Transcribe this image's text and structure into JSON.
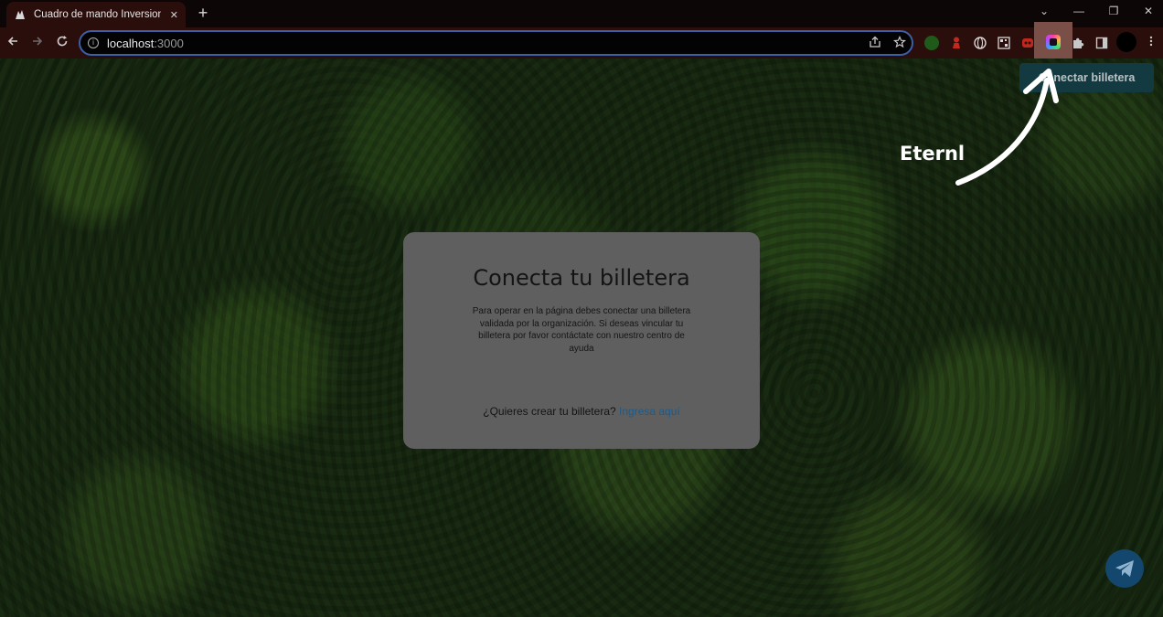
{
  "browser": {
    "tab_title": "Cuadro de mando Inversionista",
    "tab_close": "✕",
    "new_tab": "+",
    "url_host": "localhost",
    "url_port": ":3000",
    "window_controls": {
      "tabs_search": "⌄",
      "minimize": "—",
      "restore": "❐",
      "close": "✕"
    },
    "extensions": [
      "green-extension-icon",
      "red-pawn-extension-icon",
      "globe-extension-icon",
      "qr-extension-icon",
      "red-extension-icon",
      "eternl-extension-icon",
      "puzzle-icon",
      "side-panel-icon"
    ]
  },
  "page": {
    "connect_button": "Conectar billetera",
    "annotation": "Eternl",
    "modal": {
      "title": "Conecta tu billetera",
      "body": "Para operar en la página debes conectar una billetera validada por la organización. Si deseas vincular tu billetera por favor contáctate con nuestro centro de ayuda",
      "footer_text": "¿Quieres crear tu billetera?",
      "footer_link": "Ingresa aquí"
    }
  },
  "colors": {
    "chrome_bg": "#2a0e0c",
    "omnibox_border": "#3d5fa8",
    "modal_bg": "#5f5f5f",
    "link": "#1b5b8c",
    "connect_button_bg": "#143a41"
  }
}
